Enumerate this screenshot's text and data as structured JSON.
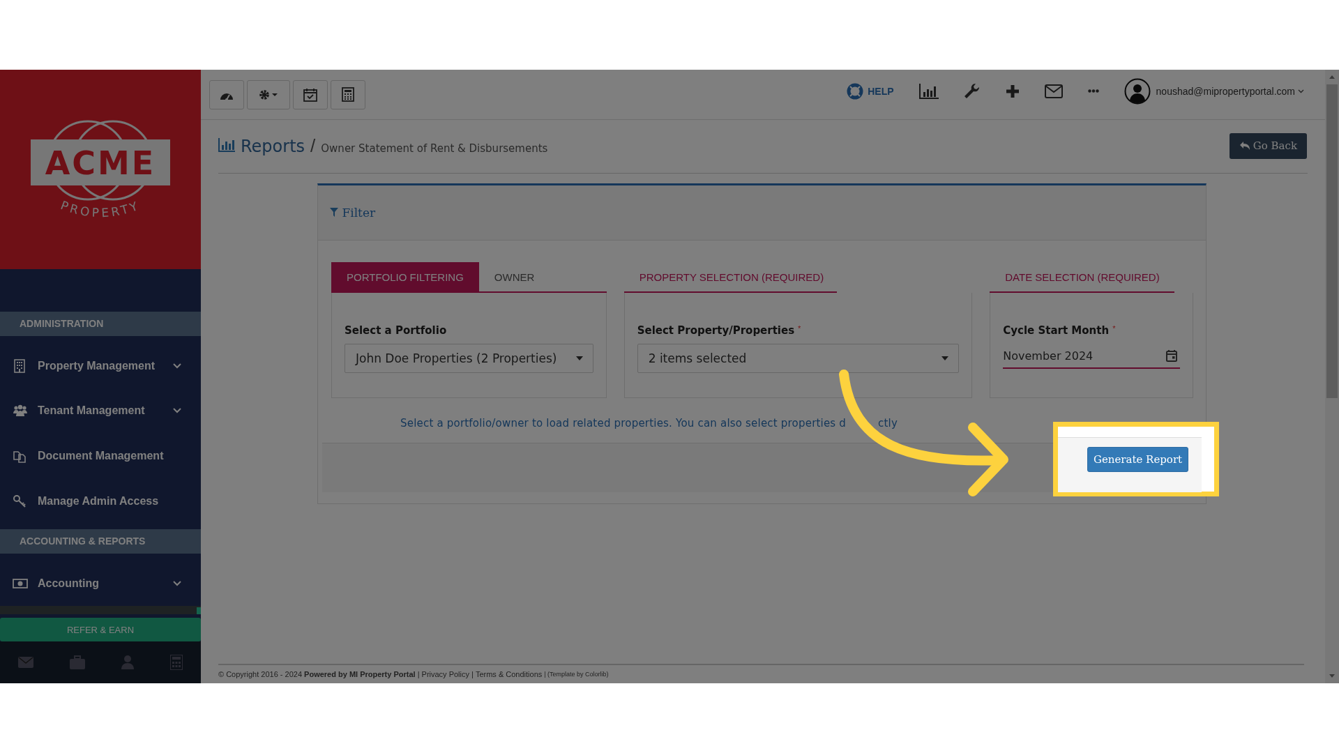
{
  "logo": {
    "name": "ACME",
    "tagline": "PROPERTY"
  },
  "sidebar": {
    "sections": [
      {
        "title": "ADMINISTRATION",
        "items": [
          {
            "label": "Property Management",
            "expandable": true
          },
          {
            "label": "Tenant Management",
            "expandable": true
          },
          {
            "label": "Document Management",
            "expandable": false
          },
          {
            "label": "Manage Admin Access",
            "expandable": false
          }
        ]
      },
      {
        "title": "ACCOUNTING & REPORTS",
        "items": [
          {
            "label": "Accounting",
            "expandable": true
          }
        ]
      }
    ],
    "refer_button": "REFER & EARN"
  },
  "top_nav": {
    "help": "HELP",
    "user_email": "noushad@mipropertyportal.com"
  },
  "breadcrumb": {
    "title": "Reports",
    "separator": "/",
    "current": "Owner Statement of Rent & Disbursements"
  },
  "go_back": "Go Back",
  "filter": {
    "title": "Filter",
    "groups": [
      {
        "tabs": [
          {
            "label": "PORTFOLIO FILTERING",
            "selected": true
          },
          {
            "label": "OWNER",
            "selected": false
          }
        ],
        "field": {
          "kind": "select",
          "label": "Select a Portfolio",
          "value": "John Doe Properties (2 Properties)"
        }
      },
      {
        "heading": "PROPERTY SELECTION (REQUIRED)",
        "field": {
          "kind": "select",
          "label": "Select Property/Properties",
          "required_mark": "*",
          "value": "2 items selected"
        }
      },
      {
        "heading": "DATE SELECTION (REQUIRED)",
        "field": {
          "kind": "date",
          "label": "Cycle Start Month",
          "required_mark": "*",
          "value": "November 2024"
        }
      }
    ],
    "hint": [
      "Select a portfolio/owner to load related properties. You can also select properties d",
      "ctly"
    ],
    "generate_button": "Generate Report"
  },
  "footer": [
    {
      "kind": "text",
      "text": "© Copyright 2016 - 2024 **Powered by MI Property Portal** |"
    },
    {
      "kind": "link",
      "text": "Privacy Policy"
    },
    {
      "kind": "text",
      "text": "|"
    },
    {
      "kind": "link",
      "text": "Terms & Conditions"
    },
    {
      "kind": "small",
      "text": "| (Template by Colorlib)"
    }
  ]
}
